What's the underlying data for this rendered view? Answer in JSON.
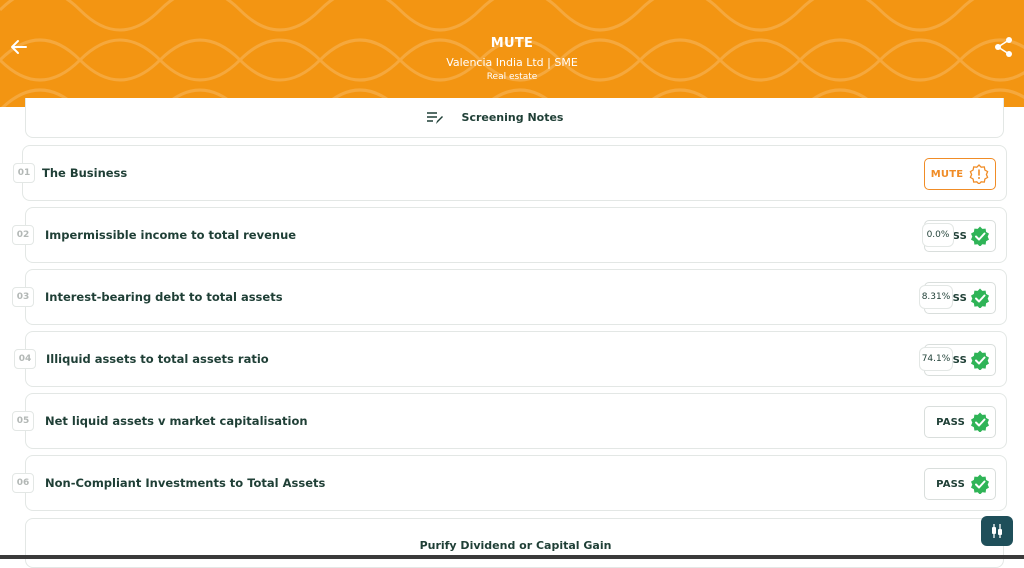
{
  "header": {
    "title": "MUTE",
    "subtitle": "Valencia India Ltd | SME",
    "sector": "Real estate",
    "bg_color": "#f39512"
  },
  "notes": {
    "label": "Screening Notes"
  },
  "rows": [
    {
      "num": "01",
      "label": "The Business",
      "status": "MUTE",
      "status_icon": "alert-badge-icon"
    },
    {
      "num": "02",
      "label": "Impermissible income to total revenue",
      "status": "SS",
      "ratio": "0.0%",
      "status_icon": "check-badge-icon"
    },
    {
      "num": "03",
      "label": "Interest-bearing debt to total assets",
      "status": "SS",
      "ratio": "8.31%",
      "status_icon": "check-badge-icon"
    },
    {
      "num": "04",
      "label": "Illiquid assets to total assets ratio",
      "status": "SS",
      "ratio": "74.1%",
      "status_icon": "check-badge-icon"
    },
    {
      "num": "05",
      "label": "Net liquid assets v market capitalisation",
      "status": "PASS",
      "status_icon": "check-badge-icon"
    },
    {
      "num": "06",
      "label": "Non-Compliant Investments to Total Assets",
      "status": "PASS",
      "status_icon": "check-badge-icon"
    }
  ],
  "purify": {
    "label": "Purify Dividend or Capital Gain"
  },
  "colors": {
    "accent": "#f39512",
    "mute": "#f08c26",
    "pass_green": "#2fb457",
    "text": "#1f3f36",
    "fab": "#1f4f5a"
  },
  "icons": {
    "back": "arrow-left-icon",
    "share": "share-icon",
    "notes": "edit-notes-icon",
    "fab": "candlestick-chart-icon"
  }
}
